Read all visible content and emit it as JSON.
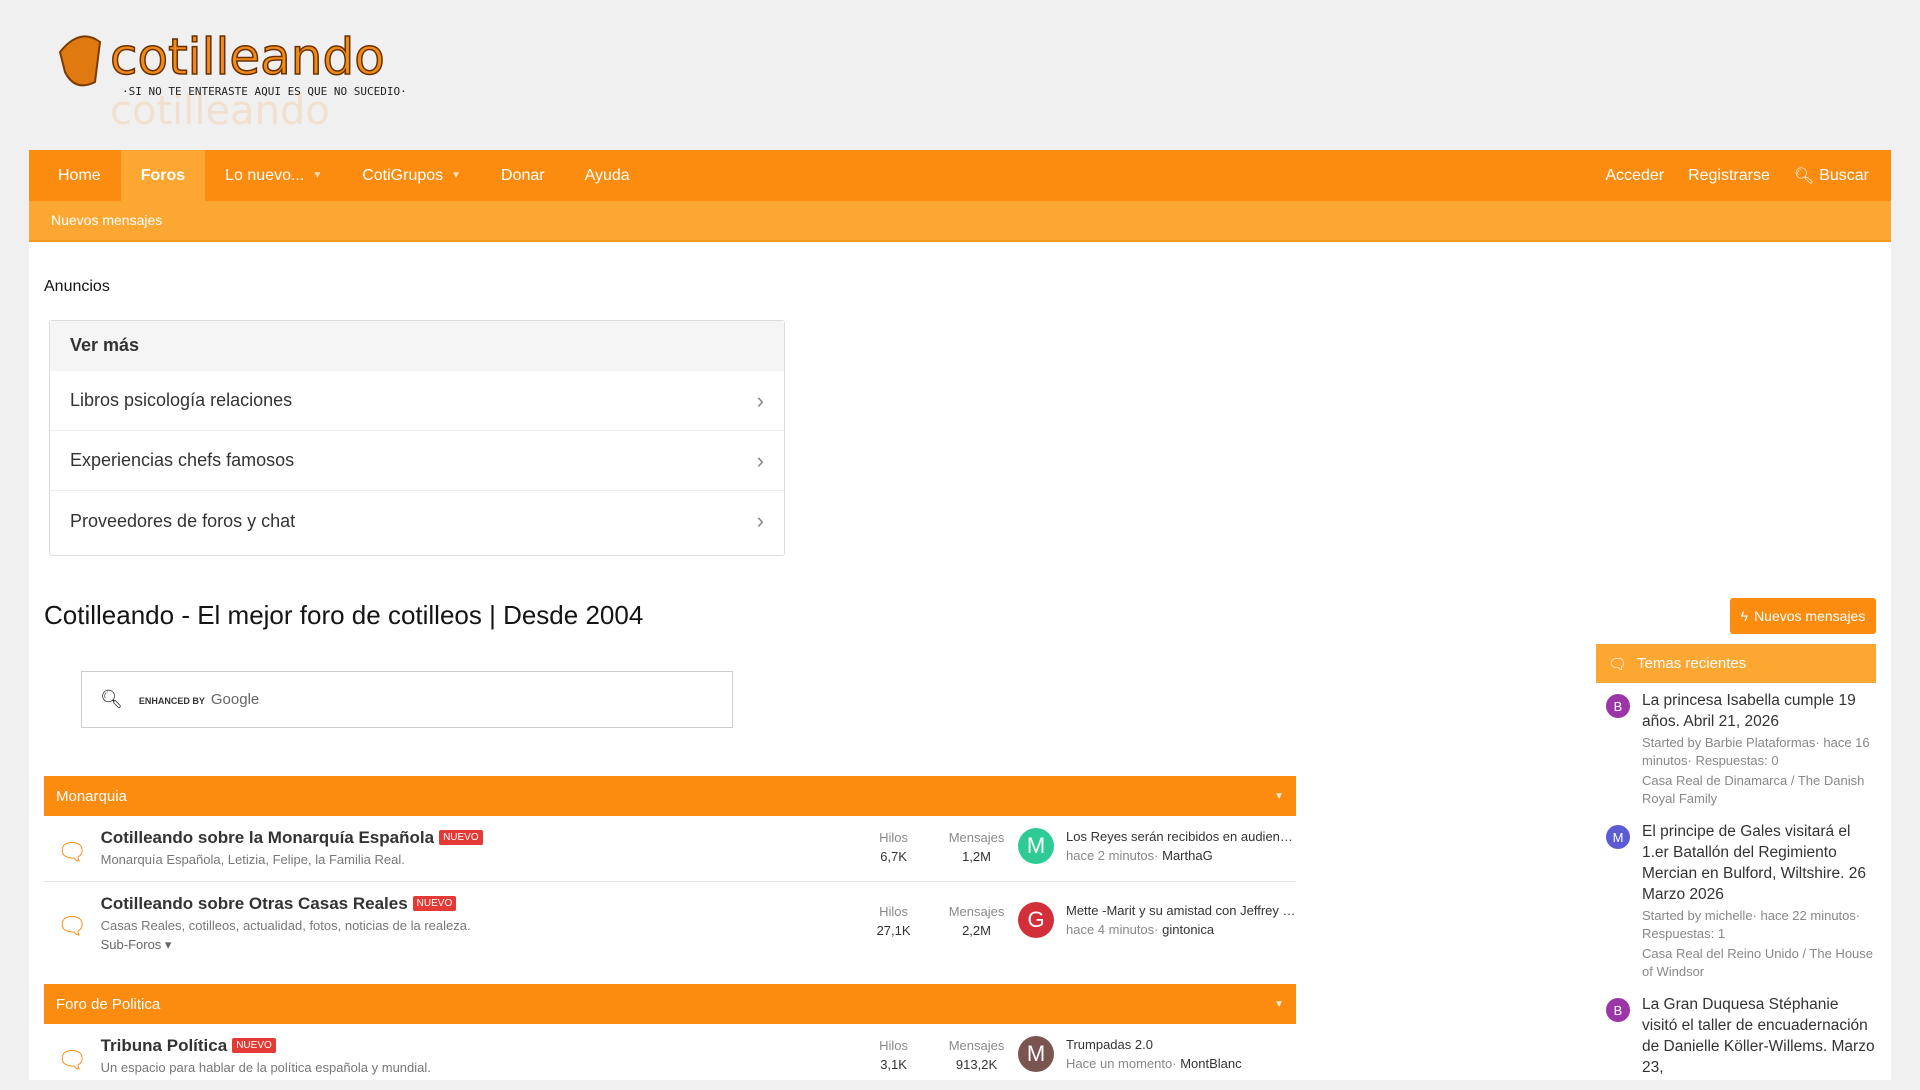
{
  "logo": {
    "text": "cotilleando",
    "tagline": "·SI NO TE ENTERASTE AQUI ES QUE NO SUCEDIO·"
  },
  "nav": {
    "items": [
      "Home",
      "Foros",
      "Lo nuevo...",
      "CotiGrupos",
      "Donar",
      "Ayuda"
    ],
    "right": [
      "Acceder",
      "Registrarse",
      "Buscar"
    ]
  },
  "subnav": {
    "item": "Nuevos mensajes"
  },
  "anuncios": "Anuncios",
  "vermas": {
    "title": "Ver más",
    "items": [
      "Libros psicología relaciones",
      "Experiencias chefs famosos",
      "Proveedores de foros y chat"
    ]
  },
  "page_title": "Cotilleando - El mejor foro de cotilleos | Desde 2004",
  "search": {
    "enhanced": "ENHANCED BY",
    "google": "Google"
  },
  "categories": [
    {
      "name": "Monarquia",
      "nodes": [
        {
          "title": "Cotilleando sobre la Monarquía Española",
          "badge": "NUEVO",
          "desc": "Monarquía Española, Letizia, Felipe, la Familia Real.",
          "hilos_label": "Hilos",
          "hilos": "6,7K",
          "mensajes_label": "Mensajes",
          "mensajes": "1,2M",
          "avatar": "M",
          "avatar_color": "#2ecc94",
          "last_title": "Los Reyes serán recibidos en audiencia...",
          "last_time": "hace 2 minutos·",
          "last_user": "MarthaG"
        },
        {
          "title": "Cotilleando sobre Otras Casas Reales",
          "badge": "NUEVO",
          "desc": "Casas Reales, cotilleos, actualidad, fotos, noticias de la realeza.",
          "sub": "Sub-Foros ▾",
          "hilos_label": "Hilos",
          "hilos": "27,1K",
          "mensajes_label": "Mensajes",
          "mensajes": "2,2M",
          "avatar": "G",
          "avatar_color": "#d32f3a",
          "last_title": "Mette -Marit y su amistad con Jeffrey Epstein",
          "last_time": "hace 4 minutos·",
          "last_user": "gintonica"
        }
      ]
    },
    {
      "name": "Foro de Politica",
      "nodes": [
        {
          "title": "Tribuna Política",
          "badge": "NUEVO",
          "desc": "Un espacio para hablar de la política española y mundial.",
          "hilos_label": "Hilos",
          "hilos": "3,1K",
          "mensajes_label": "Mensajes",
          "mensajes": "913,2K",
          "avatar": "M",
          "avatar_color": "#7a5550",
          "last_title": "Trumpadas 2.0",
          "last_time": "Hace un momento·",
          "last_user": "MontBlanc"
        }
      ]
    }
  ],
  "sidebar": {
    "new_button": "Nuevos mensajes",
    "recent_title": "Temas recientes",
    "items": [
      {
        "avatar": "B",
        "color": "#9b35a8",
        "title": "La princesa Isabella cumple 19 años. Abril 21, 2026",
        "meta": "Started by Barbie Plataformas· hace 16 minutos· Respuestas: 0",
        "forum": "Casa Real de Dinamarca / The Danish Royal Family"
      },
      {
        "avatar": "M",
        "color": "#5b5bd6",
        "title": "El principe de Gales visitará el 1.er Batallón del Regimiento Mercian en Bulford, Wiltshire. 26 Marzo 2026",
        "meta": "Started by michelle· hace 22 minutos· Respuestas: 1",
        "forum": "Casa Real del Reino Unido / The House of Windsor"
      },
      {
        "avatar": "B",
        "color": "#9b35a8",
        "title": "La Gran Duquesa Stéphanie visitó el taller de encuadernación de Danielle Köller-Willems. Marzo 23,",
        "meta": "",
        "forum": ""
      }
    ]
  }
}
